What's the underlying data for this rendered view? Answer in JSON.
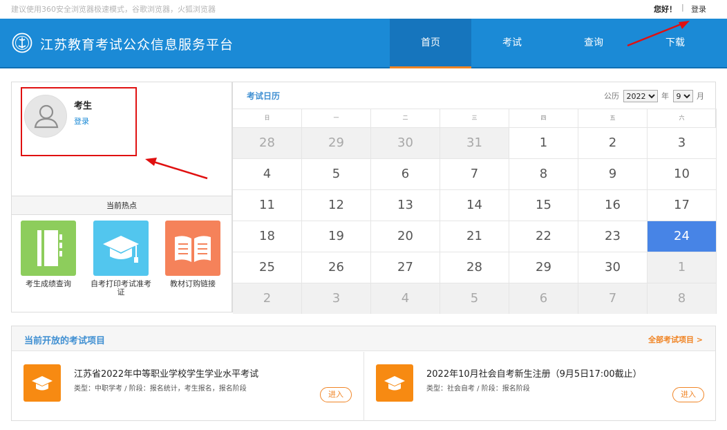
{
  "topbar": {
    "tip": "建议使用360安全浏览器极速模式，谷歌浏览器，火狐浏览器",
    "hello": "您好！",
    "separator": "|",
    "login": "登录"
  },
  "header": {
    "title": "江苏教育考试公众信息服务平台",
    "nav": [
      "首页",
      "考试",
      "查询",
      "下载"
    ],
    "active_index": 0,
    "color": "#1b8ad6"
  },
  "user": {
    "name": "考生",
    "login": "登录"
  },
  "hot": {
    "heading": "当前热点",
    "items": [
      {
        "label": "考生成绩查询",
        "icon": "notebook-icon",
        "color": "#8dcd5c"
      },
      {
        "label": "自考打印考试准考证",
        "icon": "graduation-cap-icon",
        "color": "#52c6ee"
      },
      {
        "label": "教材订购链接",
        "icon": "open-book-icon",
        "color": "#f5825a"
      }
    ]
  },
  "calendar": {
    "title": "考试日历",
    "calendar_label": "公历",
    "year": "2022",
    "year_unit": "年",
    "month": "9",
    "month_unit": "月",
    "weekdays": [
      "日",
      "一",
      "二",
      "三",
      "四",
      "五",
      "六"
    ],
    "weeks": [
      [
        "28",
        "29",
        "30",
        "31",
        "1",
        "2",
        "3"
      ],
      [
        "4",
        "5",
        "6",
        "7",
        "8",
        "9",
        "10"
      ],
      [
        "11",
        "12",
        "13",
        "14",
        "15",
        "16",
        "17"
      ],
      [
        "18",
        "19",
        "20",
        "21",
        "22",
        "23",
        "24"
      ],
      [
        "25",
        "26",
        "27",
        "28",
        "29",
        "30",
        "1"
      ],
      [
        "2",
        "3",
        "4",
        "5",
        "6",
        "7",
        "8"
      ]
    ],
    "other_month_cells": [
      [
        0,
        0
      ],
      [
        0,
        1
      ],
      [
        0,
        2
      ],
      [
        0,
        3
      ],
      [
        4,
        6
      ],
      [
        5,
        0
      ],
      [
        5,
        1
      ],
      [
        5,
        2
      ],
      [
        5,
        3
      ],
      [
        5,
        4
      ],
      [
        5,
        5
      ],
      [
        5,
        6
      ]
    ],
    "today_cell": [
      3,
      6
    ],
    "today_color": "#4784e6"
  },
  "exams": {
    "heading": "当前开放的考试项目",
    "all_link": "全部考试项目 >",
    "items": [
      {
        "name": "江苏省2022年中等职业学校学生学业水平考试",
        "desc": "类型：中职学考 / 阶段：报名统计，考生报名，报名阶段",
        "button": "进入",
        "icon": "graduation-cap-icon"
      },
      {
        "name": "2022年10月社会自考新生注册（9月5日17:00截止）",
        "desc": "类型：社会自考 / 阶段：报名阶段",
        "button": "进入",
        "icon": "graduation-cap-icon"
      }
    ]
  }
}
